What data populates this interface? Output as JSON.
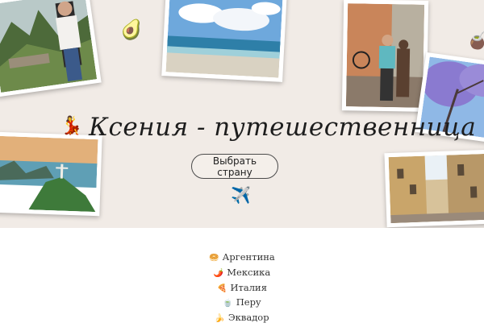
{
  "hero": {
    "title": "Ксения - путешественница",
    "cta_label": "Выбрать страну"
  },
  "countries": [
    {
      "icon": "🥯",
      "name": "Аргентина"
    },
    {
      "icon": "🌶️",
      "name": "Мексика"
    },
    {
      "icon": "🍕",
      "name": "Италия"
    },
    {
      "icon": "🍵",
      "name": "Перу"
    },
    {
      "icon": "🍌",
      "name": "Эквадор"
    }
  ],
  "stickers": {
    "avocado": "🥑",
    "dancer": "💃",
    "airplane": "✈️",
    "mate": "🧉"
  },
  "colors": {
    "hero_bg": "#f1ebe6",
    "page_bg": "#ffffff"
  }
}
